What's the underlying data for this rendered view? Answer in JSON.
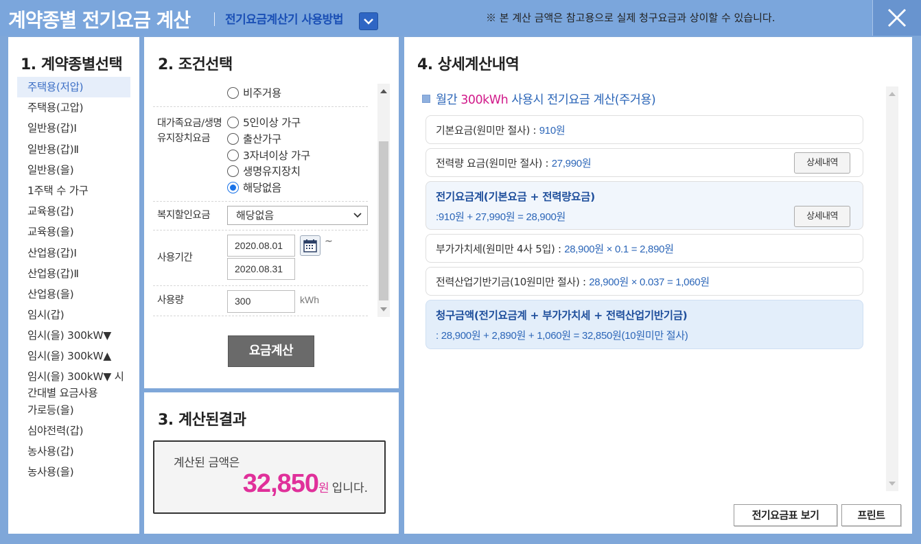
{
  "header": {
    "title": "계약종별 전기요금 계산",
    "help_link": "전기요금계산기 사용방법",
    "notice": "※ 본 계산 금액은 참고용으로 실제 청구요금과 상이할 수 있습니다."
  },
  "panel1": {
    "heading": "1. 계약종별선택",
    "items": [
      "주택용(저압)",
      "주택용(고압)",
      "일반용(갑)Ⅰ",
      "일반용(갑)Ⅱ",
      "일반용(을)",
      "1주택 수 가구",
      "교육용(갑)",
      "교육용(을)",
      "산업용(갑)Ⅰ",
      "산업용(갑)Ⅱ",
      "산업용(을)",
      "임시(갑)",
      "임시(을) 300kW▼",
      "임시(을) 300kW▲",
      "임시(을) 300kW▼ 시간대별 요금사용",
      "가로등(을)",
      "심야전력(갑)",
      "농사용(갑)",
      "농사용(을)"
    ],
    "selected": "주택용(저압)"
  },
  "panel2": {
    "heading": "2. 조건선택",
    "residence_option": "비주거용",
    "family_label": "대가족요금/생명유지장치요금",
    "family_options": [
      "5인이상 가구",
      "출산가구",
      "3자녀이상 가구",
      "생명유지장치",
      "해당없음"
    ],
    "family_selected": "해당없음",
    "welfare_label": "복지할인요금",
    "welfare_value": "해당없음",
    "period_label": "사용기간",
    "start_date": "2020.08.01",
    "end_date": "2020.08.31",
    "tilde": "~",
    "usage_label": "사용량",
    "usage_value": "300",
    "usage_unit": "kWh",
    "calc_button": "요금계산"
  },
  "panel3": {
    "heading": "3. 계산된결과",
    "label": "계산된 금액은",
    "amount": "32,850",
    "unit": "원",
    "suffix": "입니다."
  },
  "panel4": {
    "heading": "4. 상세계산내역",
    "subheading_pre": "월간 ",
    "subheading_hl": "300kWh",
    "subheading_post": " 사용시 전기요금 계산(주거용)",
    "base_fee_label": "기본요금(원미만 절사) : ",
    "base_fee_value": "910원",
    "energy_fee_label": "전력량 요금(원미만 절사) : ",
    "energy_fee_value": "27,990원",
    "detail_button": "상세내역",
    "subtotal_title": "전기요금계(기본요금 + 전력량요금)",
    "subtotal_formula": ":910원 + 27,990원 = 28,900원",
    "vat_label": "부가가치세(원미만 4사 5입) : ",
    "vat_formula": "28,900원 × 0.1 = 2,890원",
    "fund_label": "전력산업기반기금(10원미만 절사) : ",
    "fund_formula": "28,900원 × 0.037 = 1,060원",
    "total_title": "청구금액(전기요금계 + 부가가치세 + 전력산업기반기금)",
    "total_formula": ": 28,900원 + 2,890원 + 1,060원 = 32,850원(10원미만 절사)",
    "rate_table_button": "전기요금표 보기",
    "print_button": "프린트"
  }
}
